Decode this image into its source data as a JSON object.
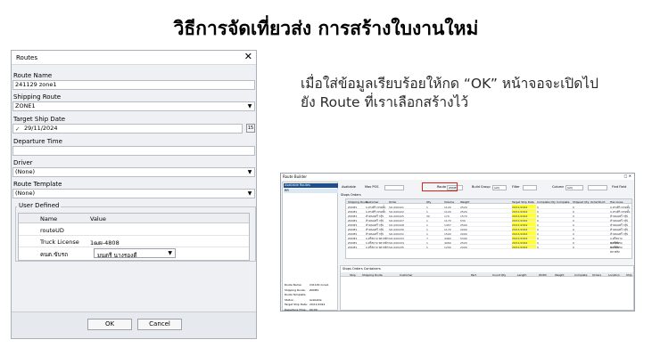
{
  "slide": {
    "title": "วิธีการจัดเที่ยวส่ง การสร้างใบงานใหม่",
    "instruction_line1": "เมื่อใส่ข้อมูลเรียบร้อยให้กด “OK” หน้าจอจะเปิดไป",
    "instruction_line2": "ยัง Route ที่เราเลือกสร้างไว้"
  },
  "dialog": {
    "title": "Routes",
    "close_glyph": "✕",
    "route_name_label": "Route Name",
    "route_name_value": "241129 zone1",
    "shipping_route_label": "Shipping Route",
    "shipping_route_value": "ZONE1",
    "target_ship_date_label": "Target Ship Date",
    "target_ship_date_checked": "✓",
    "target_ship_date_value": "29/11/2024",
    "calendar_button": "15",
    "departure_time_label": "Departure Time",
    "departure_time_value": "",
    "driver_label": "Driver",
    "driver_value": "(None)",
    "route_template_label": "Route Template",
    "route_template_value": "(None)",
    "user_defined_label": "User Defined",
    "ud_columns": [
      "Name",
      "Value"
    ],
    "ud_rows": [
      {
        "name": "routeUD",
        "value": ""
      },
      {
        "name": "Truck License",
        "value": "1ฒผ-4808"
      },
      {
        "name": "คนต.ขับรถ",
        "value": "มนตรี นางรองดี"
      }
    ],
    "ok_label": "OK",
    "cancel_label": "Cancel"
  },
  "route_builder": {
    "title": "Route Builder",
    "window_buttons": "□   ✕",
    "left_header": "Available Routes",
    "left_selected": "RR",
    "toolbar": {
      "available": "Available",
      "max_pos": "Max POS",
      "route_lbl": "Route",
      "route_val": "ZONE1",
      "build_group": "Build Group",
      "build_group_val": "(all)",
      "filter": "Filter",
      "column": "Column",
      "column_val": "(all)",
      "find_field": "Find Field"
    },
    "tabs": "Stops   Orders",
    "grid_columns": [
      "Shipping Route",
      "Customer",
      "Order",
      "Qty",
      "Volume",
      "Weight",
      "Target Ship Date",
      "Complete Qty",
      "Complete",
      "Shipped Qty",
      "OrderShort",
      "Has Lines"
    ],
    "grid_rows": [
      [
        "ZONE1",
        "บ.ทรงศิริ เทรดดิ้ง",
        "SO-000421",
        "1",
        "1120",
        "2520",
        "29/11/2024",
        "0",
        "",
        "0",
        "",
        "บ.ทรงศิริ เทรดดิ้ง"
      ],
      [
        "ZONE1",
        "บ.ทรงศิริ เทรดดิ้ง",
        "SO-000422",
        "1",
        "1120",
        "2520",
        "29/11/2024",
        "0",
        "",
        "0",
        "",
        "บ.ทรงศิริ เทรดดิ้ง"
      ],
      [
        "ZONE1",
        "ห้างทองศรี กรุ๊ป",
        "SO-000425",
        "30",
        "170",
        "1570",
        "29/11/2024",
        "0",
        "",
        "0",
        "",
        "ห้างทองศรี กรุ๊ป"
      ],
      [
        "ZONE1",
        "ห้างทองศรี กรุ๊ป",
        "SO-000427",
        "1",
        "1170",
        "530",
        "29/11/2024",
        "0",
        "",
        "0",
        "",
        "ห้างทองศรี กรุ๊ป"
      ],
      [
        "ZONE1",
        "ห้างทองศรี กรุ๊ป",
        "SO-000428",
        "1",
        "1457",
        "2500",
        "29/11/2024",
        "0",
        "",
        "0",
        "",
        "ห้างทองศรี กรุ๊ป"
      ],
      [
        "ZONE1",
        "ห้างทองศรี กรุ๊ป",
        "SO-000430",
        "1",
        "1170",
        "2000",
        "29/11/2024",
        "0",
        "",
        "0",
        "",
        "ห้างทองศรี กรุ๊ป"
      ],
      [
        "ZONE1",
        "ห้างทองศรี กรุ๊ป",
        "SO-000431",
        "1",
        "1500",
        "2000",
        "29/11/2024",
        "0",
        "",
        "0",
        "",
        "ห้างทองศรี กรุ๊ป"
      ],
      [
        "ZONE1",
        "บ.ศรีสยาม พลาสติก",
        "SO-000433",
        "7",
        "4460",
        "5390",
        "29/11/2024",
        "0",
        "",
        "0",
        "",
        "บ.ศรีสยาม พลาสติก"
      ],
      [
        "ZONE1",
        "บ.ศรีสยาม พลาสติก",
        "SO-000434",
        "1",
        "4060",
        "2520",
        "29/11/2024",
        "0",
        "",
        "0",
        "",
        "บ.ศรีสยาม พลาสติก"
      ],
      [
        "ZONE1",
        "บ.ศรีสยาม พลาสติก",
        "SO-000435",
        "1",
        "1200",
        "2000",
        "29/11/2024",
        "0",
        "",
        "0",
        "",
        "บ.ศรีสยาม พลาสติก"
      ]
    ],
    "bottom_tabs": "Stops   Orders   Containers",
    "bottom_columns": [
      "Stop",
      "Shipping Route",
      "Customer",
      "Part",
      "Count Qty",
      "Length",
      "Width",
      "Weight",
      "Complete",
      "Orders",
      "Location",
      "Ship"
    ],
    "info": [
      {
        "k": "Route Name:",
        "v": "241129 zone1"
      },
      {
        "k": "Shipping Route:",
        "v": "ZONE1"
      },
      {
        "k": "Route Template:",
        "v": ""
      },
      {
        "k": "Status:",
        "v": "Available"
      },
      {
        "k": "Target Ship Date:",
        "v": "29/11/2024"
      },
      {
        "k": "Departure Time:",
        "v": "00:00"
      }
    ]
  }
}
